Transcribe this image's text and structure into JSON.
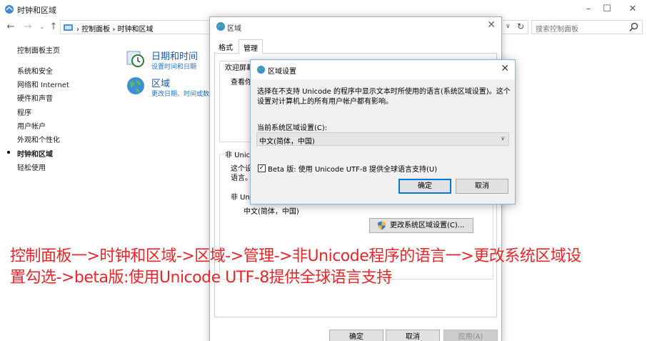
{
  "control_panel": {
    "title": "时钟和区域",
    "breadcrumb": [
      "控制面板",
      "时钟和区域"
    ],
    "search_placeholder": "搜索控制面板",
    "sidebar": {
      "home": "控制面板主页",
      "items": [
        {
          "label": "系统和安全",
          "current": false
        },
        {
          "label": "网络和 Internet",
          "current": false
        },
        {
          "label": "硬件和声音",
          "current": false
        },
        {
          "label": "程序",
          "current": false
        },
        {
          "label": "用户帐户",
          "current": false
        },
        {
          "label": "外观和个性化",
          "current": false
        },
        {
          "label": "时钟和区域",
          "current": true
        },
        {
          "label": "轻松使用",
          "current": false
        }
      ]
    },
    "categories": [
      {
        "title": "日期和时间",
        "links": "设置时间和日期",
        "icon": "clock-icon"
      },
      {
        "title": "区域",
        "links": "更改日期、时间或数",
        "icon": "globe-icon"
      }
    ]
  },
  "region_dialog": {
    "title": "区域",
    "tabs": [
      {
        "label": "格式",
        "active": false
      },
      {
        "label": "管理",
        "active": true
      }
    ],
    "welcome_heading": "欢迎屏幕",
    "welcome_text": "查看你",
    "nonunicode_heading": "非 Unicode",
    "nonunicode_text_1": "这个设",
    "nonunicode_text_2": "语言。",
    "nonunicode_sub": "非 Uni",
    "current_locale": "中文(简体，中国)",
    "change_locale_button": "更改系统区域设置(C)...",
    "ok": "确定",
    "cancel": "取消",
    "apply": "应用(A)"
  },
  "locale_dialog": {
    "title": "区域设置",
    "description": "选择在不支持 Unicode 的程序中显示文本时所使用的语言(系统区域设置)。这个设置对计算机上的所有用户帐户都有影响。",
    "current_label": "当前系统区域设置(C):",
    "current_value": "中文(简体，中国)",
    "beta_checkbox_label": "Beta 版: 使用 Unicode UTF-8 提供全球语言支持(U)",
    "beta_checked": true,
    "ok": "确定",
    "cancel": "取消"
  },
  "annotation": {
    "line1": "控制面板一>时钟和区域->区域->管理->非Unicode程序的语言一>更改系统区域设",
    "line2": "置勾选->beta版:使用Unicode UTF-8提供全球语言支持",
    "color": "#e8262a"
  },
  "colors": {
    "link_blue": "#1e73c8",
    "heading_blue": "#1e5aa8",
    "focus_blue": "#0078d7"
  }
}
